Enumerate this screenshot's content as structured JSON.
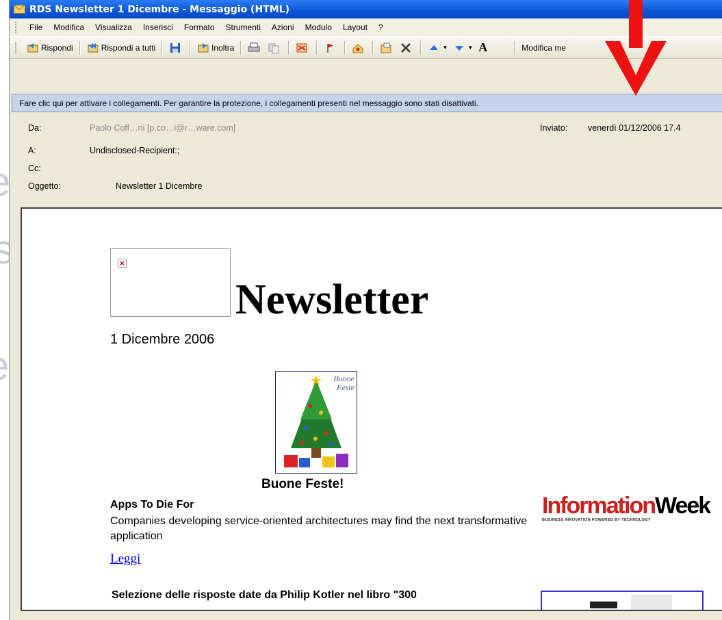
{
  "window": {
    "title": "RDS Newsletter 1 Dicembre  - Messaggio (HTML)"
  },
  "menu": [
    "File",
    "Modifica",
    "Visualizza",
    "Inserisci",
    "Formato",
    "Strumenti",
    "Azioni",
    "Modulo",
    "Layout",
    "?"
  ],
  "toolbar": {
    "reply": "Rispondi",
    "reply_all": "Rispondi a tutti",
    "forward": "Inoltra",
    "edit_message": "Modifica me"
  },
  "infobar": {
    "text": "Fare clic qui per attivare i collegamenti. Per garantire la protezione, i collegamenti presenti nel messaggio sono stati disattivati."
  },
  "header": {
    "from_label": "Da:",
    "from_value": "Paolo Coff…ni [p.co…i@r…ware.com]",
    "sent_label": "Inviato:",
    "sent_value": "venerdì 01/12/2006 17.4",
    "to_label": "A:",
    "to_value": "Undisclosed-Recipient:;",
    "cc_label": "Cc:",
    "subject_label": "Oggetto:",
    "subject_value": "Newsletter 1 Dicembre"
  },
  "body": {
    "newsletter_title": "Newsletter",
    "date": "1 Dicembre 2006",
    "card_text_1": "Buone",
    "card_text_2": "Feste",
    "greeting": "Buone Feste!",
    "article1_title": "Apps To Die For",
    "article1_desc": "Companies developing service-oriented architectures may find the next transformative application",
    "article1_link": "Leggi",
    "iw_logo_a": "Information",
    "iw_logo_b": "Week",
    "iw_tagline": "BUSINESS INNOVATION POWERED BY TECHNOLOGY",
    "article2_title": "Selezione delle risposte date da Philip Kotler nel libro \"300"
  },
  "colors": {
    "titlebar": "#0a56d8",
    "infobar": "#c6d3ec",
    "arrow": "#ee1111",
    "link": "#0000ee",
    "iw_red": "#cc1f1f"
  },
  "icons": [
    "mail-icon",
    "reply-icon",
    "reply-all-icon",
    "save-icon",
    "forward-icon",
    "print-icon",
    "copy-icon",
    "move-icon",
    "flag-icon",
    "address-book-icon",
    "move-to-folder-icon",
    "delete-icon",
    "previous-item-icon",
    "next-item-icon",
    "font-size-icon"
  ]
}
